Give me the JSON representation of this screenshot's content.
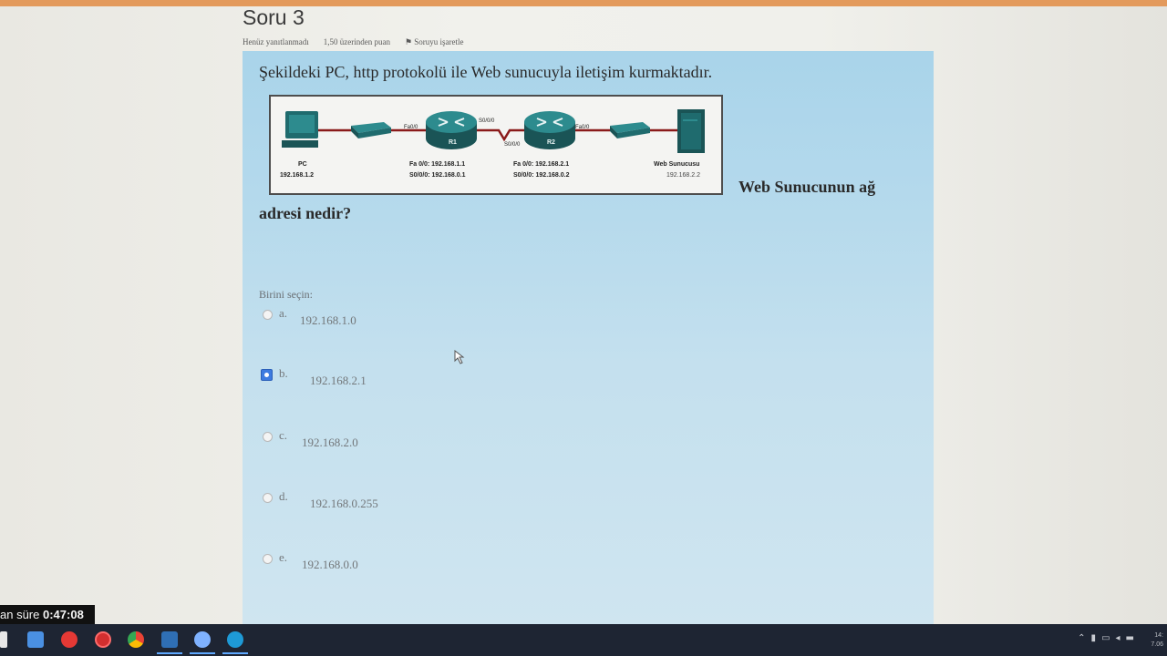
{
  "question": {
    "title": "Soru 3",
    "status": "Henüz yanıtlanmadı",
    "points": "1,50 üzerinden puan",
    "flag_label": "Soruyu işaretle",
    "text": "Şekildeki PC, http protokolü ile Web sunucuyla iletişim kurmaktadır.",
    "text2_part1": "Web Sunucunun ağ",
    "text2_part2": "adresi nedir?"
  },
  "diagram": {
    "pc_label": "PC",
    "pc_ip": "192.168.1.2",
    "r1_name": "R1",
    "r1_fa": "Fa 0/0: 192.168.1.1",
    "r1_s": "S0/0/0: 192.168.0.1",
    "r2_name": "R2",
    "r2_fa": "Fa 0/0: 192.168.2.1",
    "r2_s": "S0/0/0: 192.168.0.2",
    "server_label": "Web Sunucusu",
    "server_ip": "192.168.2.2",
    "port_fa_left": "Fa0/0",
    "port_s_r1": "S0/0/0",
    "port_s_r2": "S0/0/0",
    "port_fa_right": "Fa0/0"
  },
  "prompt": "Birini seçin:",
  "options": [
    {
      "letter": "a.",
      "value": "192.168.1.0",
      "selected": false
    },
    {
      "letter": "b.",
      "value": "192.168.2.1",
      "selected": true
    },
    {
      "letter": "c.",
      "value": "192.168.2.0",
      "selected": false
    },
    {
      "letter": "d.",
      "value": "192.168.0.255",
      "selected": false
    },
    {
      "letter": "e.",
      "value": "192.168.0.0",
      "selected": false
    }
  ],
  "timer": {
    "prefix": "an süre",
    "value": "0:47:08"
  },
  "taskbar": {
    "icons": [
      "start-icon",
      "mail-icon",
      "youtube-icon",
      "opera-icon",
      "chrome-icon",
      "app-icon",
      "browser-icon",
      "edge-icon"
    ],
    "clock_time": "14:",
    "clock_date": "7.06"
  },
  "colors": {
    "panel": "#b4d9ec",
    "accent_orange": "#e39a5c",
    "radio_selected": "#3d7be0",
    "link_red": "#8a1a1a",
    "device_teal": "#1f6b6e"
  }
}
